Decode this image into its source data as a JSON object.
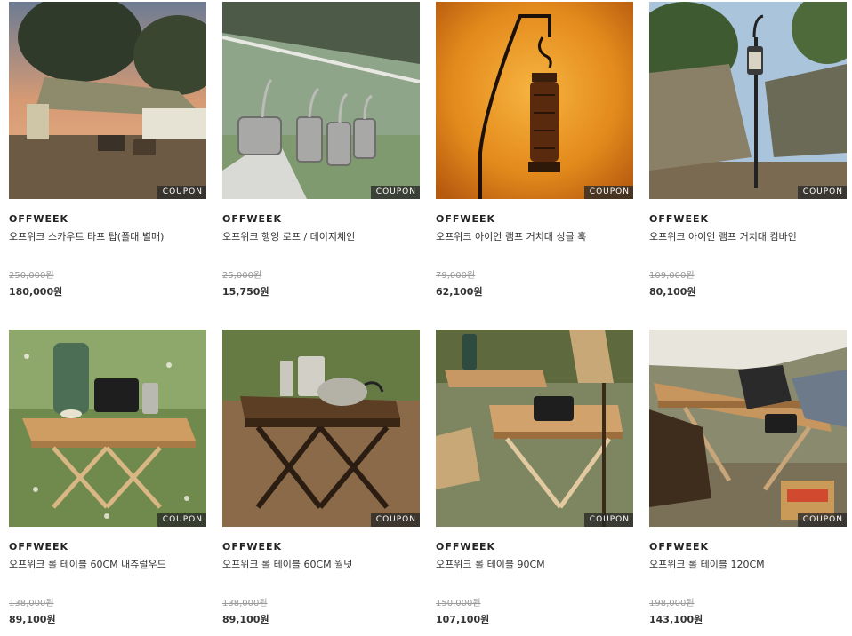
{
  "products": [
    {
      "brand": "OFFWEEK",
      "name": "오프위크 스카우트 타프 탑(폴대 별매)",
      "original_price": "250,000원",
      "price": "180,000원",
      "badge": "COUPON"
    },
    {
      "brand": "OFFWEEK",
      "name": "오프위크 행잉 로프 / 데이지체인",
      "original_price": "25,000원",
      "price": "15,750원",
      "badge": "COUPON"
    },
    {
      "brand": "OFFWEEK",
      "name": "오프위크 아이언 램프 거치대 싱글 훅",
      "original_price": "79,000원",
      "price": "62,100원",
      "badge": "COUPON"
    },
    {
      "brand": "OFFWEEK",
      "name": "오프위크 아이언 램프 거치대 컴바인",
      "original_price": "109,000원",
      "price": "80,100원",
      "badge": "COUPON"
    },
    {
      "brand": "OFFWEEK",
      "name": "오프위크 롤 테이블 60CM 내츄럴우드",
      "original_price": "138,000원",
      "price": "89,100원",
      "badge": "COUPON"
    },
    {
      "brand": "OFFWEEK",
      "name": "오프위크 롤 테이블 60CM 월넛",
      "original_price": "138,000원",
      "price": "89,100원",
      "badge": "COUPON"
    },
    {
      "brand": "OFFWEEK",
      "name": "오프위크 롤 테이블 90CM",
      "original_price": "150,000원",
      "price": "107,100원",
      "badge": "COUPON"
    },
    {
      "brand": "OFFWEEK",
      "name": "오프위크 롤 테이블 120CM",
      "original_price": "198,000원",
      "price": "143,100원",
      "badge": "COUPON"
    }
  ],
  "images": [
    "tarp-camping-photo",
    "hanging-rope-cups-photo",
    "lantern-hook-sunset-photo",
    "tent-lantern-stand-photo",
    "table-natural-wood-photo",
    "table-walnut-photo",
    "table-90cm-photo",
    "table-120cm-photo"
  ]
}
